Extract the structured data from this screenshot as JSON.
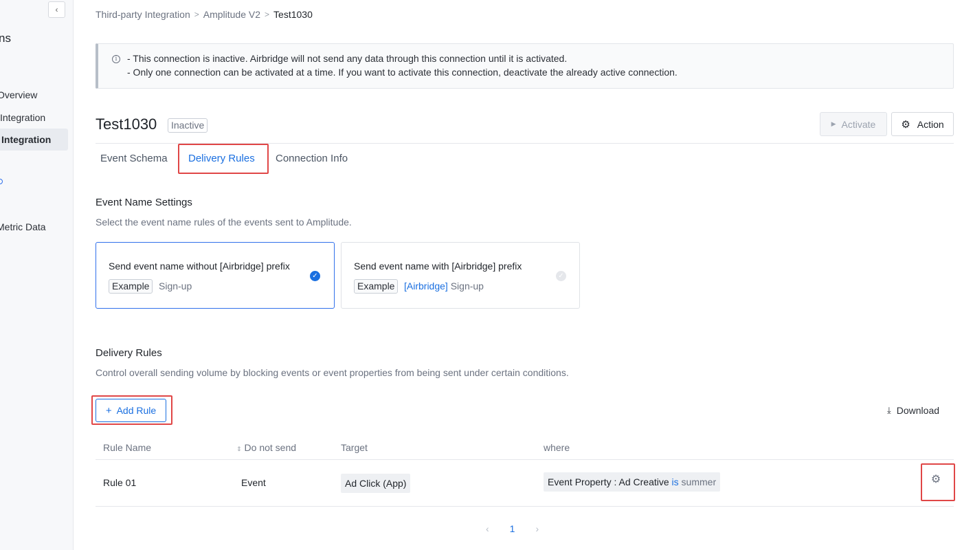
{
  "sidebar": {
    "collapse_label": "‹",
    "title": "ns",
    "items": [
      {
        "label": "Overview"
      },
      {
        "label": "Integration"
      },
      {
        "label": "Integration"
      },
      {
        "label": "Metric Data"
      }
    ]
  },
  "breadcrumb": {
    "items": [
      "Third-party Integration",
      "Amplitude V2",
      "Test1030"
    ],
    "separator": ">"
  },
  "notice": {
    "icon": "info-icon",
    "line1": "- This connection is inactive. Airbridge will not send any data through this connection until it is activated.",
    "line2": "- Only one connection can be activated at a time. If you want to activate this connection, deactivate the already active connection."
  },
  "header": {
    "title": "Test1030",
    "status": "Inactive",
    "activate_label": "Activate",
    "action_label": "Action"
  },
  "tabs": [
    {
      "label": "Event Schema"
    },
    {
      "label": "Delivery Rules",
      "active": true
    },
    {
      "label": "Connection Info"
    }
  ],
  "event_name_settings": {
    "title": "Event Name Settings",
    "description": "Select the event name rules of the events sent to Amplitude.",
    "options": [
      {
        "title": "Send event name without [Airbridge] prefix",
        "example_label": "Example",
        "prefix": "",
        "value": "Sign-up",
        "selected": true
      },
      {
        "title": "Send event name with [Airbridge] prefix",
        "example_label": "Example",
        "prefix": "[Airbridge]",
        "value": "Sign-up",
        "selected": false
      }
    ]
  },
  "delivery_rules": {
    "title": "Delivery Rules",
    "description": "Control overall sending volume by blocking events or event properties from being sent under certain conditions.",
    "add_rule_label": "Add Rule",
    "download_label": "Download",
    "columns": [
      "Rule Name",
      "Do not send",
      "Target",
      "where"
    ],
    "rows": [
      {
        "rule_name": "Rule 01",
        "do_not_send": "Event",
        "target": "Ad Click (App)",
        "where_field": "Event Property : Ad Creative",
        "where_op": "is",
        "where_value": "summer"
      }
    ]
  },
  "pagination": {
    "prev": "‹",
    "current": "1",
    "next": "›"
  },
  "colors": {
    "accent": "#1a6fe0",
    "highlight": "#e04646"
  }
}
